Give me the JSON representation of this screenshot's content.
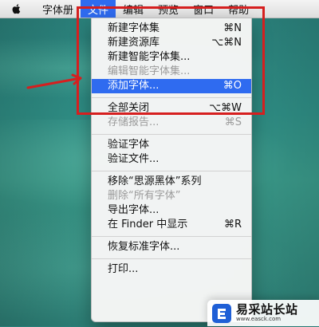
{
  "menubar": {
    "items": [
      {
        "label": "字体册"
      },
      {
        "label": "文件"
      },
      {
        "label": "编辑"
      },
      {
        "label": "预览"
      },
      {
        "label": "窗口"
      },
      {
        "label": "帮助"
      }
    ],
    "active_index": 1
  },
  "file_menu": {
    "items": [
      {
        "label": "新建字体集",
        "shortcut": "⌘N",
        "enabled": true
      },
      {
        "label": "新建资源库",
        "shortcut": "⌥⌘N",
        "enabled": true
      },
      {
        "label": "新建智能字体集...",
        "shortcut": "",
        "enabled": true
      },
      {
        "label": "编辑智能字体集...",
        "shortcut": "",
        "enabled": false
      },
      {
        "label": "添加字体...",
        "shortcut": "⌘O",
        "enabled": true,
        "highlighted": true
      },
      {
        "separator": true
      },
      {
        "label": "全部关闭",
        "shortcut": "⌥⌘W",
        "enabled": true
      },
      {
        "label": "存储报告...",
        "shortcut": "⌘S",
        "enabled": false
      },
      {
        "separator": true
      },
      {
        "label": "验证字体",
        "shortcut": "",
        "enabled": true
      },
      {
        "label": "验证文件...",
        "shortcut": "",
        "enabled": true
      },
      {
        "separator": true
      },
      {
        "label": "移除“思源黑体”系列",
        "shortcut": "",
        "enabled": true
      },
      {
        "label": "删除“所有字体”",
        "shortcut": "",
        "enabled": false
      },
      {
        "label": "导出字体...",
        "shortcut": "",
        "enabled": true
      },
      {
        "label": "在 Finder 中显示",
        "shortcut": "⌘R",
        "enabled": true
      },
      {
        "separator": true
      },
      {
        "label": "恢复标准字体...",
        "shortcut": "",
        "enabled": true
      },
      {
        "separator": true
      },
      {
        "label": "打印...",
        "shortcut": "",
        "enabled": true
      }
    ]
  },
  "annotations": {
    "highlight_color": "#d61f1f"
  },
  "watermark": {
    "main": "易采站长站",
    "sub": "www.easck.com"
  },
  "colors": {
    "menu_highlight": "#2f6bf0"
  }
}
